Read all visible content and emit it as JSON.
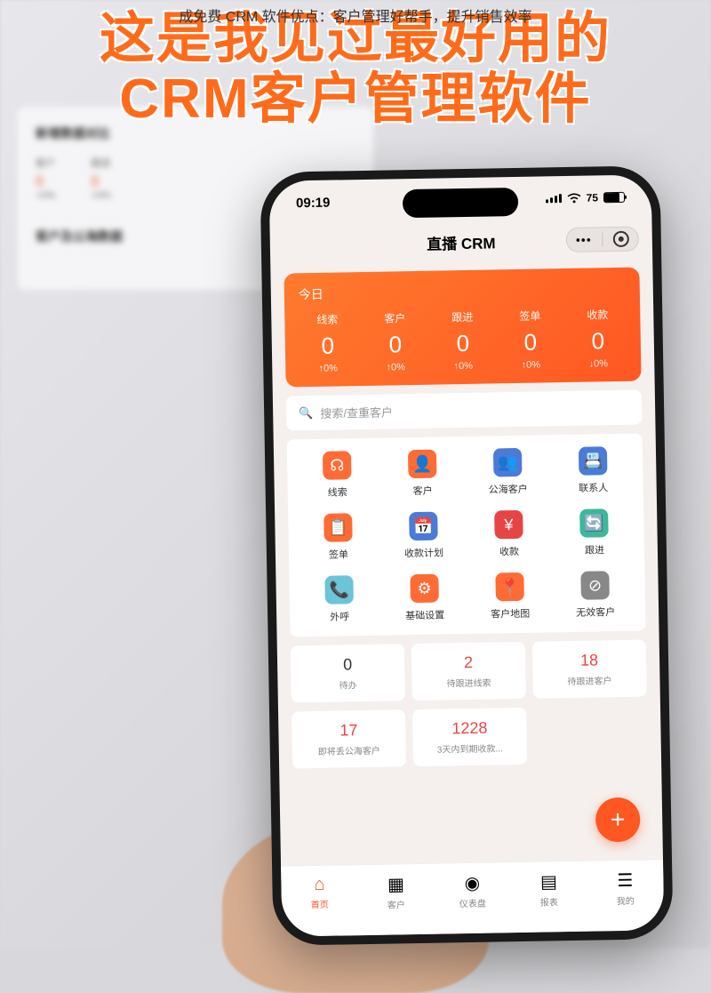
{
  "caption": "成免费 CRM 软件优点：客户管理好帮手，提升销售效率",
  "headline_line1": "这是我见过最好用的",
  "headline_line2": "CRM客户管理软件",
  "desktop": {
    "section1_title": "新增数据对比",
    "col1": "客户",
    "col2": "跟进",
    "stat1": "0",
    "stat2": "0",
    "change1": "+0%",
    "change2": "+0%",
    "section2_title": "客户及公海数据"
  },
  "phone": {
    "status": {
      "time": "09:19",
      "battery": "75"
    },
    "header": {
      "title": "直播 CRM"
    },
    "today": {
      "label": "今日",
      "stats": [
        {
          "name": "线索",
          "value": "0",
          "change": "↑0%"
        },
        {
          "name": "客户",
          "value": "0",
          "change": "↑0%"
        },
        {
          "name": "跟进",
          "value": "0",
          "change": "↑0%"
        },
        {
          "name": "签单",
          "value": "0",
          "change": "↑0%"
        },
        {
          "name": "收款",
          "value": "0",
          "change": "↓0%"
        }
      ]
    },
    "search": {
      "placeholder": "搜索/查重客户"
    },
    "grid": [
      [
        {
          "label": "线索",
          "bg": "#ff6b35",
          "icon": "☊"
        },
        {
          "label": "客户",
          "bg": "#ff6b35",
          "icon": "👤"
        },
        {
          "label": "公海客户",
          "bg": "#4a7bd8",
          "icon": "👥"
        },
        {
          "label": "联系人",
          "bg": "#4a7bd8",
          "icon": "📇"
        }
      ],
      [
        {
          "label": "签单",
          "bg": "#ff6b35",
          "icon": "📋"
        },
        {
          "label": "收款计划",
          "bg": "#4a7bd8",
          "icon": "📅"
        },
        {
          "label": "收款",
          "bg": "#e64545",
          "icon": "¥"
        },
        {
          "label": "跟进",
          "bg": "#3cb89a",
          "icon": "🔄"
        }
      ],
      [
        {
          "label": "外呼",
          "bg": "#6bc4d8",
          "icon": "📞"
        },
        {
          "label": "基础设置",
          "bg": "#ff6b35",
          "icon": "⚙"
        },
        {
          "label": "客户地图",
          "bg": "#ff6b35",
          "icon": "📍"
        },
        {
          "label": "无效客户",
          "bg": "#888",
          "icon": "⊘"
        }
      ]
    ],
    "summary": [
      {
        "value": "0",
        "label": "待办",
        "color": "#333"
      },
      {
        "value": "2",
        "label": "待跟进线索",
        "color": "#e64545"
      },
      {
        "value": "18",
        "label": "待跟进客户",
        "color": "#e64545"
      },
      {
        "value": "17",
        "label": "即将丢公海客户",
        "color": "#e64545"
      },
      {
        "value": "1228",
        "label": "3天内到期收款...",
        "color": "#e64545"
      }
    ],
    "nav": [
      {
        "label": "首页",
        "icon": "⌂",
        "active": true
      },
      {
        "label": "客户",
        "icon": "▦",
        "active": false
      },
      {
        "label": "仪表盘",
        "icon": "◉",
        "active": false
      },
      {
        "label": "报表",
        "icon": "▤",
        "active": false
      },
      {
        "label": "我的",
        "icon": "☰",
        "active": false
      }
    ]
  }
}
